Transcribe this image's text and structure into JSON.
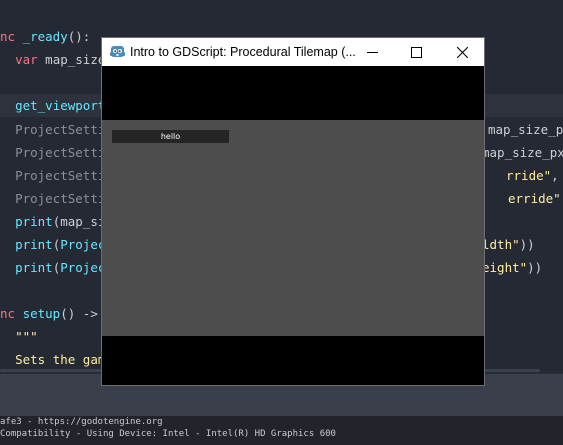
{
  "editor": {
    "lines": [
      {
        "parts": [
          {
            "t": "nc ",
            "c": "kw"
          },
          {
            "t": "_ready",
            "c": "fn"
          },
          {
            "t": "():",
            "c": "tx"
          }
        ]
      },
      {
        "parts": [
          {
            "t": "  ",
            "c": "tx"
          },
          {
            "t": "var ",
            "c": "kw"
          },
          {
            "t": "map_size",
            "c": "tx"
          }
        ]
      },
      {
        "parts": []
      },
      {
        "parts": [
          {
            "t": "  ",
            "c": "tx"
          },
          {
            "t": "get_viewport",
            "c": "fn"
          }
        ],
        "current": true
      },
      {
        "parts": [
          {
            "t": "  ",
            "c": "tx"
          },
          {
            "t": "ProjectSetti",
            "c": "dim"
          }
        ],
        "right": [
          {
            "t": "map_size_p",
            "c": "tx"
          }
        ]
      },
      {
        "parts": [
          {
            "t": "  ",
            "c": "tx"
          },
          {
            "t": "ProjectSetti",
            "c": "dim"
          }
        ],
        "right": [
          {
            "t": "map_size_px",
            "c": "tx"
          }
        ]
      },
      {
        "parts": [
          {
            "t": "  ",
            "c": "tx"
          },
          {
            "t": "ProjectSetti",
            "c": "dim"
          }
        ],
        "right": [
          {
            "t": "rride\"",
            "c": "str"
          },
          {
            "t": ", map_",
            "c": "tx"
          }
        ]
      },
      {
        "parts": [
          {
            "t": "  ",
            "c": "tx"
          },
          {
            "t": "ProjectSetti",
            "c": "dim"
          }
        ],
        "right": [
          {
            "t": "erride\"",
            "c": "str"
          },
          {
            "t": ", map_",
            "c": "tx"
          }
        ]
      },
      {
        "parts": [
          {
            "t": "  ",
            "c": "tx"
          },
          {
            "t": "print",
            "c": "fn"
          },
          {
            "t": "(map_siz",
            "c": "tx"
          }
        ]
      },
      {
        "parts": [
          {
            "t": "  ",
            "c": "tx"
          },
          {
            "t": "print",
            "c": "fn"
          },
          {
            "t": "(",
            "c": "tx"
          },
          {
            "t": "Project",
            "c": "fn"
          }
        ],
        "right": [
          {
            "t": "ldth\"",
            "c": "str"
          },
          {
            "t": "))",
            "c": "tx"
          }
        ]
      },
      {
        "parts": [
          {
            "t": "  ",
            "c": "tx"
          },
          {
            "t": "print",
            "c": "fn"
          },
          {
            "t": "(",
            "c": "tx"
          },
          {
            "t": "Project",
            "c": "fn"
          }
        ],
        "right": [
          {
            "t": "eight\"",
            "c": "str"
          },
          {
            "t": "))",
            "c": "tx"
          }
        ]
      },
      {
        "parts": []
      },
      {
        "parts": [
          {
            "t": "nc ",
            "c": "kw"
          },
          {
            "t": "setup",
            "c": "fn"
          },
          {
            "t": "() -> ",
            "c": "tx"
          }
        ]
      },
      {
        "parts": [
          {
            "t": "  ",
            "c": "tx"
          },
          {
            "t": "\"\"\"",
            "c": "str"
          }
        ]
      },
      {
        "parts": [
          {
            "t": "  ",
            "c": "tx"
          },
          {
            "t": "Sets the gam",
            "c": "str"
          }
        ]
      }
    ]
  },
  "output": {
    "lines": [
      "afe3 - https://godotengine.org",
      "Compatibility - Using Device: Intel - Intel(R) HD Graphics 600"
    ]
  },
  "window": {
    "title": "Intro to GDScript: Procedural Tilemap (...",
    "icon": "godot-icon",
    "label_text": "hello"
  },
  "colors": {
    "editor_bg": "#252934",
    "game_bg": "#4d4d4d",
    "keyword": "#ff7085",
    "function": "#66e6ff",
    "string": "#ffeda1"
  }
}
